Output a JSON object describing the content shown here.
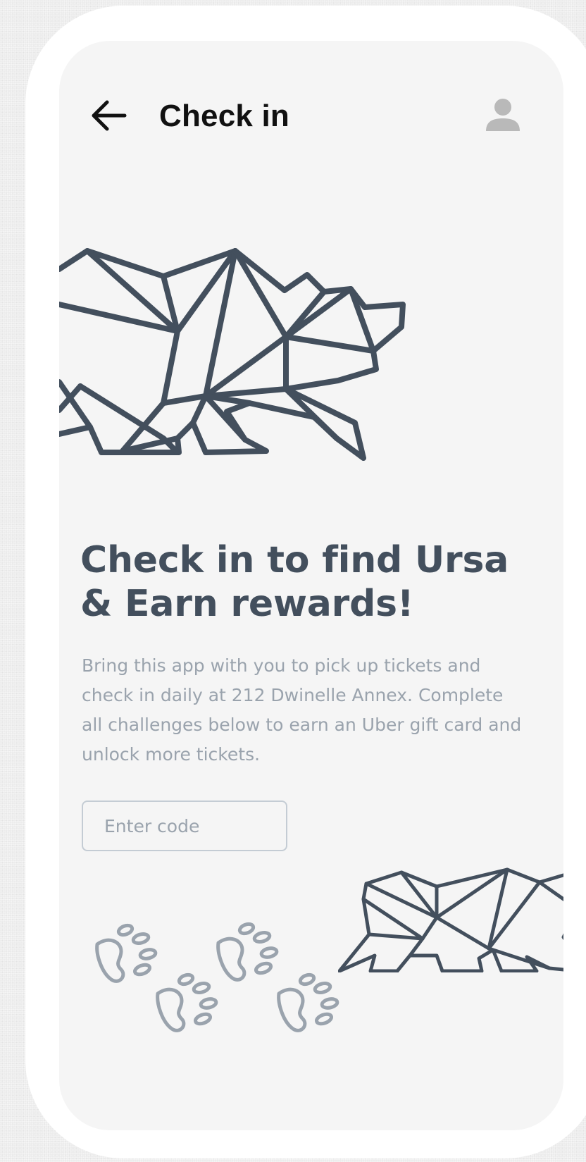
{
  "header": {
    "title": "Check in",
    "back_icon": "arrow-left-icon",
    "profile_icon": "person-icon"
  },
  "hero": {
    "illustration": "geometric-bear-icon"
  },
  "content": {
    "headline": "Check in to find Ursa & Earn rewards!",
    "description": "Bring this app with you to pick up tickets and check in daily at 212 Dwinelle Annex. Complete all challenges below to earn an Uber gift card and unlock more tickets."
  },
  "code_input": {
    "value": "",
    "placeholder": "Enter code"
  },
  "decor": {
    "paw_icon": "paw-print-icon",
    "small_bear_icon": "geometric-bear-icon"
  },
  "colors": {
    "screen_background": "#f5f5f5",
    "frame": "#ffffff",
    "heading": "#434f5d",
    "body_text": "#9aa3ad",
    "title_text": "#111111",
    "bear_stroke": "#434f5d",
    "paw_stroke": "#9aa3ad",
    "avatar": "#b9b9b9",
    "input_border": "#c4ccd4"
  }
}
